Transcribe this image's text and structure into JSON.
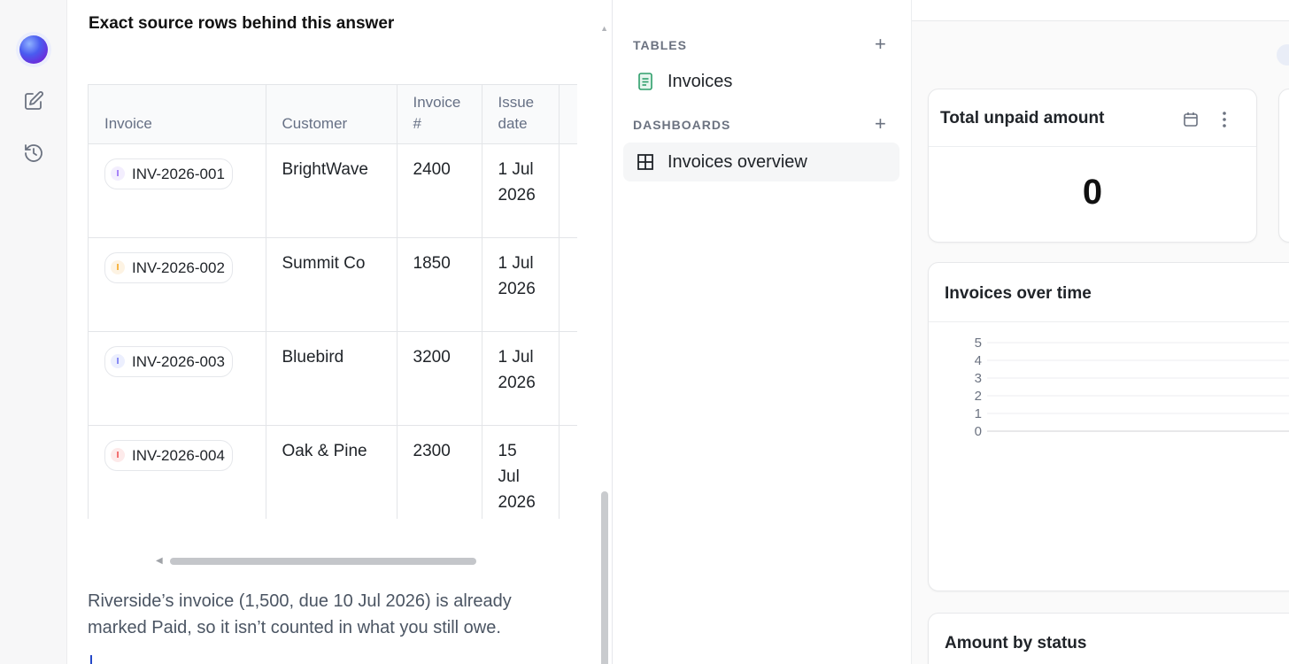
{
  "rail": {
    "icons": [
      "logo-icon",
      "assistant-orb-icon",
      "edit-icon",
      "history-icon"
    ]
  },
  "answer": {
    "heading": "Exact source rows behind this answer",
    "columns": [
      "Invoice",
      "Customer",
      "Invoice #",
      "Issue date"
    ],
    "rows": [
      {
        "invoice": "INV-2026-001",
        "customer": "BrightWave",
        "number": "2400",
        "issue_date": "1 Jul 2026",
        "color": "#8b5cf6",
        "bg": "#f3eefe"
      },
      {
        "invoice": "INV-2026-002",
        "customer": "Summit Co",
        "number": "1850",
        "issue_date": "1 Jul 2026",
        "color": "#f59e0b",
        "bg": "#fdf3e3"
      },
      {
        "invoice": "INV-2026-003",
        "customer": "Bluebird",
        "number": "3200",
        "issue_date": "1 Jul 2026",
        "color": "#6366f1",
        "bg": "#eceffe"
      },
      {
        "invoice": "INV-2026-004",
        "customer": "Oak & Pine",
        "number": "2300",
        "issue_date": "15 Jul 2026",
        "color": "#ef4444",
        "bg": "#fdeaea"
      }
    ],
    "paragraph": "Riverside’s invoice (1,500, due 10 Jul 2026) is already marked Paid, so it isn’t counted in what you still owe."
  },
  "nav": {
    "tables_label": "TABLES",
    "tables": [
      {
        "label": "Invoices",
        "icon": "table-sheet-icon"
      }
    ],
    "dashboards_label": "DASHBOARDS",
    "dashboards": [
      {
        "label": "Invoices overview",
        "icon": "grid-icon"
      }
    ]
  },
  "dashboard": {
    "kpi_title": "Total unpaid amount",
    "kpi_value": "0",
    "chart_title": "Invoices over time",
    "status_title": "Amount by status",
    "accent": "#2e9e6b"
  },
  "chart_data": {
    "type": "line",
    "title": "Invoices over time",
    "xlabel": "",
    "ylabel": "",
    "yticks": [
      "5",
      "4",
      "3",
      "2",
      "1",
      "0"
    ],
    "ylim": [
      0,
      5
    ],
    "series": [],
    "grid": true
  }
}
